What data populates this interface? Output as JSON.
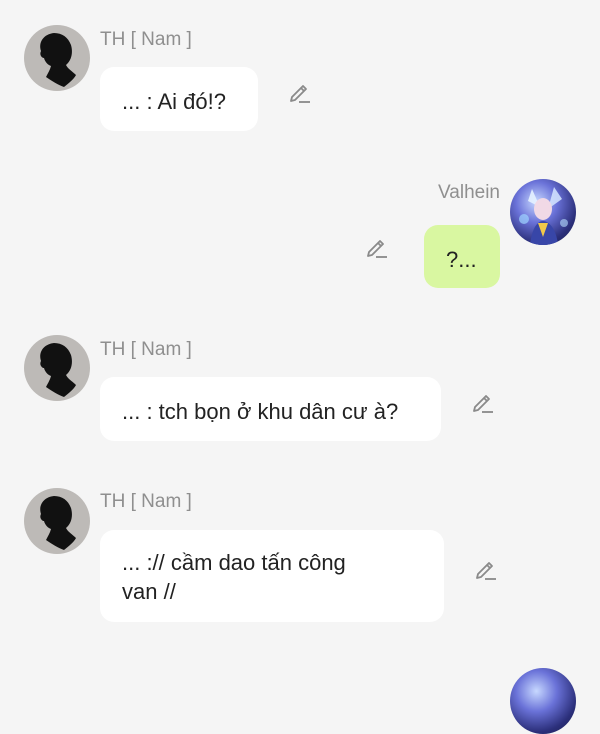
{
  "messages": [
    {
      "sender": "TH [ Nam ]",
      "text": "... : Ai đó!?",
      "direction": "incoming",
      "avatar_icon": "silhouette-avatar"
    },
    {
      "sender": "Valhein",
      "text": "?...",
      "direction": "outgoing",
      "avatar_icon": "hero-avatar"
    },
    {
      "sender": "TH [ Nam ]",
      "text": "... : tch bọn ở khu dân cư à?",
      "direction": "incoming",
      "avatar_icon": "silhouette-avatar"
    },
    {
      "sender": "TH [ Nam ]",
      "text": "... :// cầm dao tấn công\nvan //",
      "direction": "incoming",
      "avatar_icon": "silhouette-avatar"
    }
  ],
  "colors": {
    "background": "#f5f5f5",
    "incoming_bubble": "#ffffff",
    "outgoing_bubble": "#d9f7a1",
    "sender_name": "#8f8f8f"
  }
}
